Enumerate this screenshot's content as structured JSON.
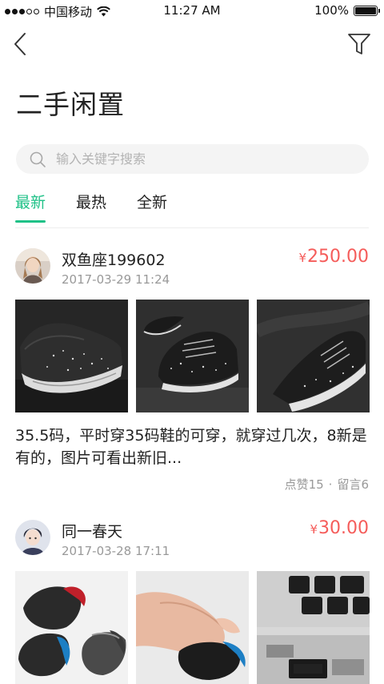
{
  "status_bar": {
    "carrier": "中国移动",
    "time": "11:27 AM",
    "battery": "100%",
    "battery_level": 1.0
  },
  "nav": {
    "back_icon": "chevron-left-icon",
    "filter_icon": "filter-icon"
  },
  "page": {
    "title": "二手闲置"
  },
  "search": {
    "placeholder": "输入关键字搜索",
    "value": ""
  },
  "tabs": [
    {
      "label": "最新",
      "active": true
    },
    {
      "label": "最热",
      "active": false
    },
    {
      "label": "全新",
      "active": false
    }
  ],
  "colors": {
    "accent": "#1fc187",
    "price": "#f55c5a",
    "muted": "#999999"
  },
  "posts": [
    {
      "username": "双鱼座199602",
      "time": "2017-03-29 11:24",
      "currency": "¥",
      "price": "250.00",
      "description": "35.5码，平时穿35码鞋的可穿，就穿过几次，8新是有的，图片可看出新旧...",
      "likes_label": "点赞15",
      "dot": "·",
      "comments_label": "留言6",
      "photos": [
        "black sneaker side view",
        "black sneaker front view",
        "black sneaker top view"
      ]
    },
    {
      "username": "同一春天",
      "time": "2017-03-28 17:11",
      "currency": "¥",
      "price": "30.00",
      "photos": [
        "wireless mice red and blue",
        "hand on blue mouse",
        "logitech usb receiver in laptop"
      ]
    }
  ]
}
